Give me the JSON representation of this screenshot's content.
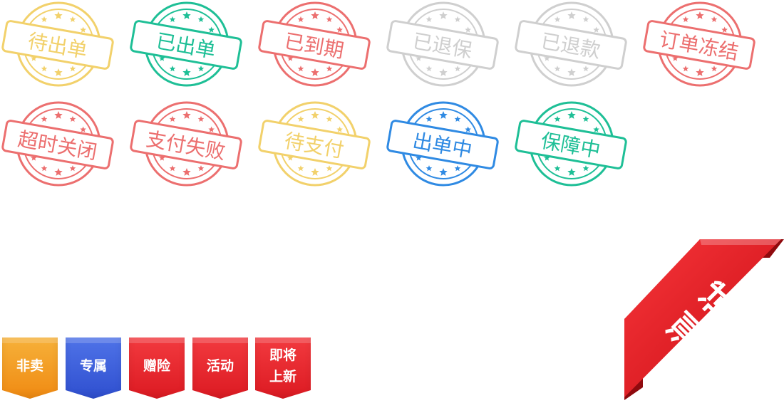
{
  "stamps": [
    {
      "label": "待出单",
      "color": "#f2d16b"
    },
    {
      "label": "已出单",
      "color": "#1ebf96"
    },
    {
      "label": "已到期",
      "color": "#ec6f6f"
    },
    {
      "label": "已退保",
      "color": "#cfcfcf"
    },
    {
      "label": "已退款",
      "color": "#cfcfcf"
    },
    {
      "label": "订单冻结",
      "color": "#ec6f6f"
    },
    {
      "label": "超时关闭",
      "color": "#ec6f6f"
    },
    {
      "label": "支付失败",
      "color": "#ec6f6f"
    },
    {
      "label": "待支付",
      "color": "#f2d16b"
    },
    {
      "label": "出单中",
      "color": "#2f8ae3"
    },
    {
      "label": "保障中",
      "color": "#1ebf96"
    }
  ],
  "ribbons": [
    {
      "label": "非卖",
      "color": "#f39a1e"
    },
    {
      "label": "专属",
      "color": "#3b5fd9"
    },
    {
      "label": "赠险",
      "color": "#e8252b"
    },
    {
      "label": "活动",
      "color": "#e8252b"
    },
    {
      "label": "即将上新",
      "color": "#e8252b"
    }
  ],
  "corner_ribbon": {
    "label": "测试",
    "color": "#e8161c"
  }
}
